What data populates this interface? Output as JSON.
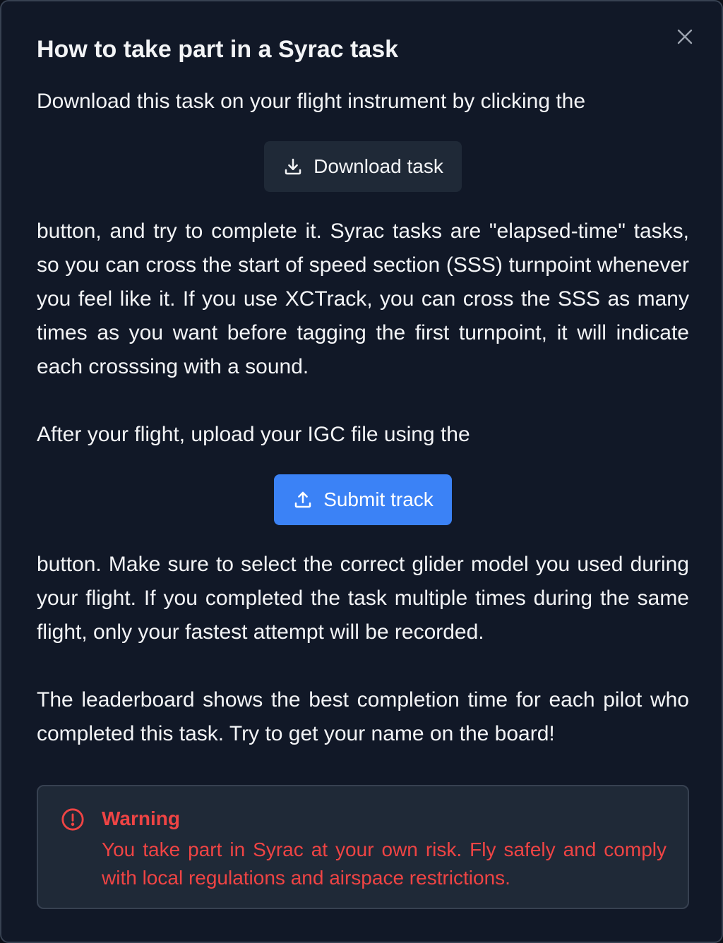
{
  "modal": {
    "title": "How to take part in a Syrac task",
    "close_icon": "close-icon"
  },
  "intro": {
    "text": "Download this task on your flight instrument by clicking the"
  },
  "download_button": {
    "label": "Download task",
    "icon": "download-icon"
  },
  "paragraph_after_download": {
    "text": "button, and try to complete it. Syrac tasks are \"elapsed-time\" tasks, so you can cross the start of speed section (SSS) turnpoint whenever you feel like it. If you use XCTrack, you can cross the SSS as many times as you want before tagging the first turnpoint, it will indicate each crosssing with a sound."
  },
  "upload_intro": {
    "text": "After your flight, upload your IGC file using the"
  },
  "submit_button": {
    "label": "Submit track",
    "icon": "upload-icon"
  },
  "paragraph_after_submit": {
    "text": "button. Make sure to select the correct glider model you used during your flight. If you completed the task multiple times during the same flight, only your fastest attempt will be recorded."
  },
  "leaderboard_paragraph": {
    "text": "The leaderboard shows the best completion time for each pilot who completed this task. Try to get your name on the board!"
  },
  "warning": {
    "title": "Warning",
    "text": "You take part in Syrac at your own risk. Fly safely and comply with local regulations and airspace restrictions.",
    "icon": "alert-circle-icon"
  },
  "colors": {
    "background": "#111827",
    "button_dark": "#1f2937",
    "accent": "#3b82f6",
    "warning": "#ef4444"
  }
}
